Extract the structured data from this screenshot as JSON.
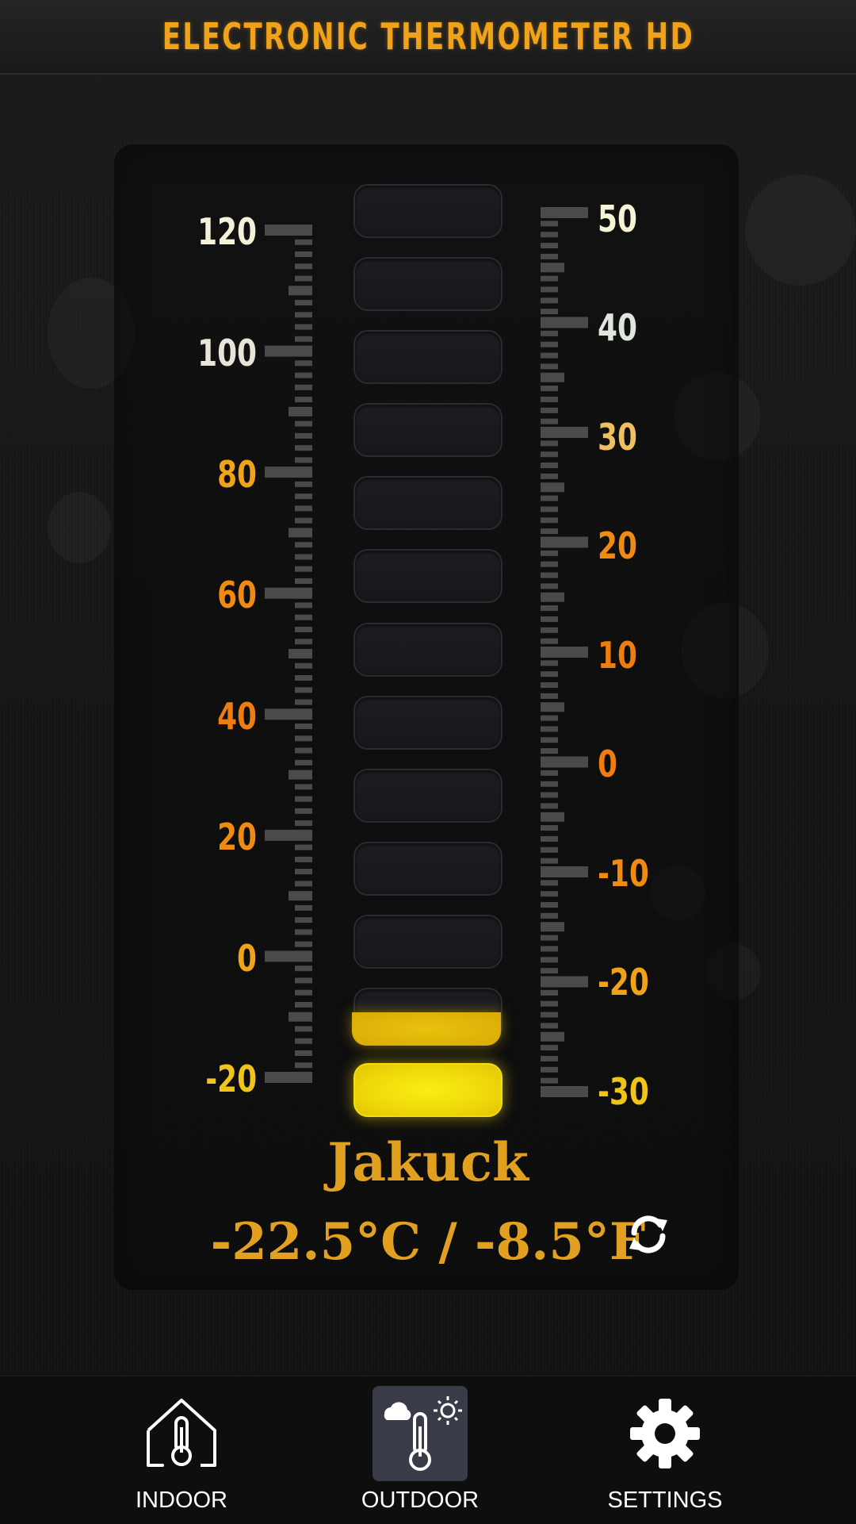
{
  "header": {
    "title": "ELECTRONIC THERMOMETER HD"
  },
  "thermometer": {
    "fahrenheit_labels": [
      "120",
      "100",
      "80",
      "60",
      "40",
      "20",
      "0",
      "-20"
    ],
    "celsius_labels": [
      "50",
      "40",
      "30",
      "20",
      "10",
      "0",
      "-10",
      "-20",
      "-30"
    ],
    "segments_total": 13,
    "segments_lit": 1,
    "partial_segment_fill_fraction": 0.55,
    "lit_color": "#f3e20c",
    "label_colors": {
      "f_120": "#f5f0d8",
      "f_100": "#e8e4d8",
      "f_80": "#f0a21a",
      "f_60": "#f08a10",
      "f_40": "#f07c10",
      "f_20": "#f08a10",
      "f_0": "#f0a21a",
      "f_-20": "#f0c418",
      "c_50": "#f7f3d6",
      "c_40": "#dfe7dd",
      "c_30": "#f0c060",
      "c_20": "#f08a10",
      "c_10": "#f07c10",
      "c_0": "#f07c10",
      "c_-10": "#f08a10",
      "c_-20": "#f0a21a",
      "c_-30": "#f0c418"
    }
  },
  "location": {
    "name": "Jakuck"
  },
  "reading": {
    "text": "-22.5°C / -8.5°F"
  },
  "refresh": {
    "icon": "refresh-icon"
  },
  "nav": {
    "indoor_label": "INDOOR",
    "outdoor_label": "OUTDOOR",
    "settings_label": "SETTINGS",
    "active": "outdoor"
  },
  "colors": {
    "accent": "#e2a020",
    "title": "#f0a21a",
    "nav_active_bg": "#3a3b48"
  }
}
